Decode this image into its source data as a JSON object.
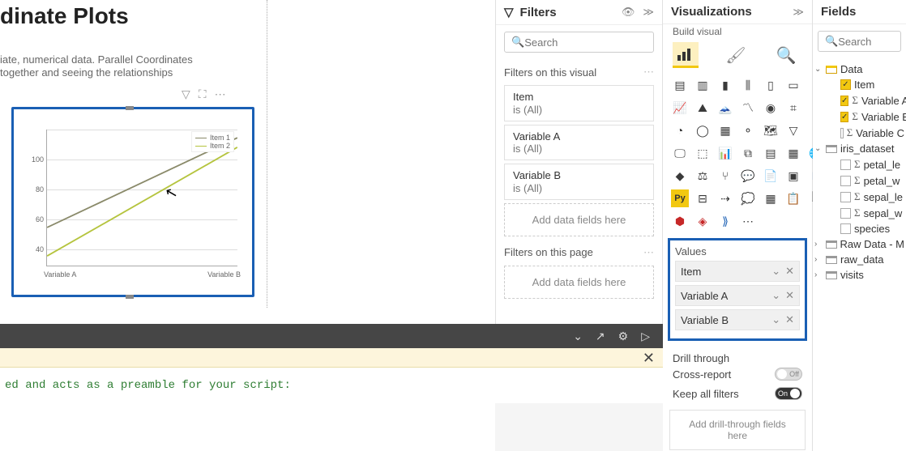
{
  "page": {
    "title": "dinate Plots",
    "subtitle1": "iate, numerical data. Parallel Coordinates",
    "subtitle2": "together and seeing the relationships"
  },
  "visual": {
    "xticks": {
      "left": "Variable A",
      "right": "Variable B"
    },
    "yticks": {
      "t40": "40",
      "t60": "60",
      "t80": "80",
      "t100": "100"
    },
    "legend": {
      "i1": "Item 1",
      "i2": "Item 2"
    }
  },
  "chart_data": {
    "type": "line",
    "categories": [
      "Variable A",
      "Variable B"
    ],
    "series": [
      {
        "name": "Item 1",
        "values": [
          55,
          115
        ],
        "color": "#8a8a6a"
      },
      {
        "name": "Item 2",
        "values": [
          36,
          108
        ],
        "color": "#b5c43e"
      }
    ],
    "title": "",
    "xlabel": "",
    "ylabel": "",
    "ylim": [
      30,
      120
    ]
  },
  "filters": {
    "pane_title": "Filters",
    "search_placeholder": "Search",
    "section_visual": "Filters on this visual",
    "section_page": "Filters on this page",
    "add_here": "Add data fields here",
    "cards": [
      {
        "name": "Item",
        "val": "is (All)"
      },
      {
        "name": "Variable A",
        "val": "is (All)"
      },
      {
        "name": "Variable B",
        "val": "is (All)"
      }
    ]
  },
  "viz": {
    "pane_title": "Visualizations",
    "sub": "Build visual",
    "values_title": "Values",
    "wells": [
      "Item",
      "Variable A",
      "Variable B"
    ],
    "drill_title": "Drill through",
    "cross": "Cross-report",
    "keep": "Keep all filters",
    "off": "Off",
    "on": "On",
    "add_drill": "Add drill-through fields here"
  },
  "fields": {
    "pane_title": "Fields",
    "search_placeholder": "Search",
    "tables": {
      "data": {
        "name": "Data",
        "cols": [
          "Item",
          "Variable A",
          "Variable B",
          "Variable C"
        ]
      },
      "iris": {
        "name": "iris_dataset",
        "cols": [
          "petal_le",
          "petal_w",
          "sepal_le",
          "sepal_w",
          "species"
        ]
      },
      "raw_m": "Raw Data - M",
      "raw": "raw_data",
      "visits": "visits"
    }
  },
  "code": {
    "line": "ed and acts as a preamble for your script:"
  }
}
